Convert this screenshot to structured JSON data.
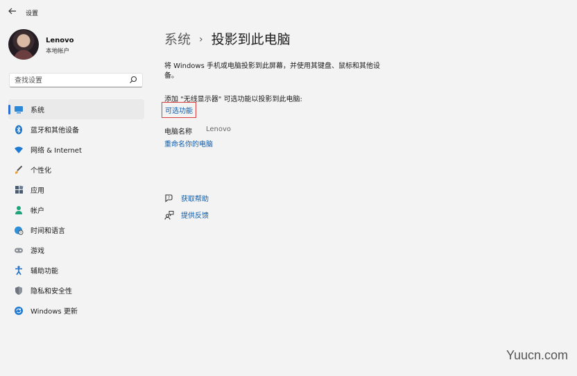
{
  "window": {
    "title": "设置"
  },
  "profile": {
    "name": "Lenovo",
    "account": "本地帐户"
  },
  "search": {
    "placeholder": "查找设置"
  },
  "sidebar": {
    "items": [
      {
        "label": "系统",
        "icon": "system-icon",
        "active": true
      },
      {
        "label": "蓝牙和其他设备",
        "icon": "bluetooth-icon"
      },
      {
        "label": "网络 & Internet",
        "icon": "wifi-icon"
      },
      {
        "label": "个性化",
        "icon": "brush-icon"
      },
      {
        "label": "应用",
        "icon": "apps-icon"
      },
      {
        "label": "帐户",
        "icon": "person-icon"
      },
      {
        "label": "时间和语言",
        "icon": "globe-clock-icon"
      },
      {
        "label": "游戏",
        "icon": "gamepad-icon"
      },
      {
        "label": "辅助功能",
        "icon": "accessibility-icon"
      },
      {
        "label": "隐私和安全性",
        "icon": "shield-icon"
      },
      {
        "label": "Windows 更新",
        "icon": "update-icon"
      }
    ]
  },
  "breadcrumb": {
    "parent": "系统",
    "separator": "›",
    "current": "投影到此电脑"
  },
  "main": {
    "description": "将 Windows 手机或电脑投影到此屏幕，并使用其键盘、鼠标和其他设备。",
    "add_text": "添加 \"无线显示器\" 可选功能以投影到此电脑:",
    "optional_features_link": "可选功能",
    "pc_name_label": "电脑名称",
    "pc_name_value": "Lenovo",
    "rename_link": "重命名你的电脑",
    "get_help": "获取帮助",
    "give_feedback": "提供反馈"
  },
  "watermark": "Yuucn.com",
  "colors": {
    "accent": "#2b6fd6",
    "link": "#0b5cad",
    "highlight_box": "#d93a3a",
    "background": "#f3f3f3"
  }
}
